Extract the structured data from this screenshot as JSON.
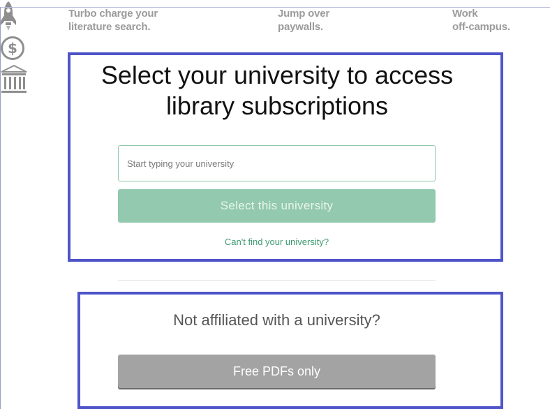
{
  "features": [
    {
      "icon": "rocket-icon",
      "line1": "Turbo charge your",
      "line2": "literature search."
    },
    {
      "icon": "dollar-icon",
      "line1": "Jump over",
      "line2": "paywalls."
    },
    {
      "icon": "library-icon",
      "line1": "Work",
      "line2": "off-campus."
    }
  ],
  "university": {
    "title_line1": "Select your university to access",
    "title_line2": "library subscriptions",
    "search_placeholder": "Start typing your university",
    "search_value": "",
    "select_button": "Select this university",
    "cant_find_link": "Can't find your university?"
  },
  "unaffiliated": {
    "heading": "Not affiliated with a university?",
    "free_button": "Free PDFs only"
  },
  "colors": {
    "highlight_border": "#4f55c9",
    "select_button_bg": "#93c9ae",
    "link_green": "#3d9970",
    "free_button_bg": "#a3a3a3"
  }
}
